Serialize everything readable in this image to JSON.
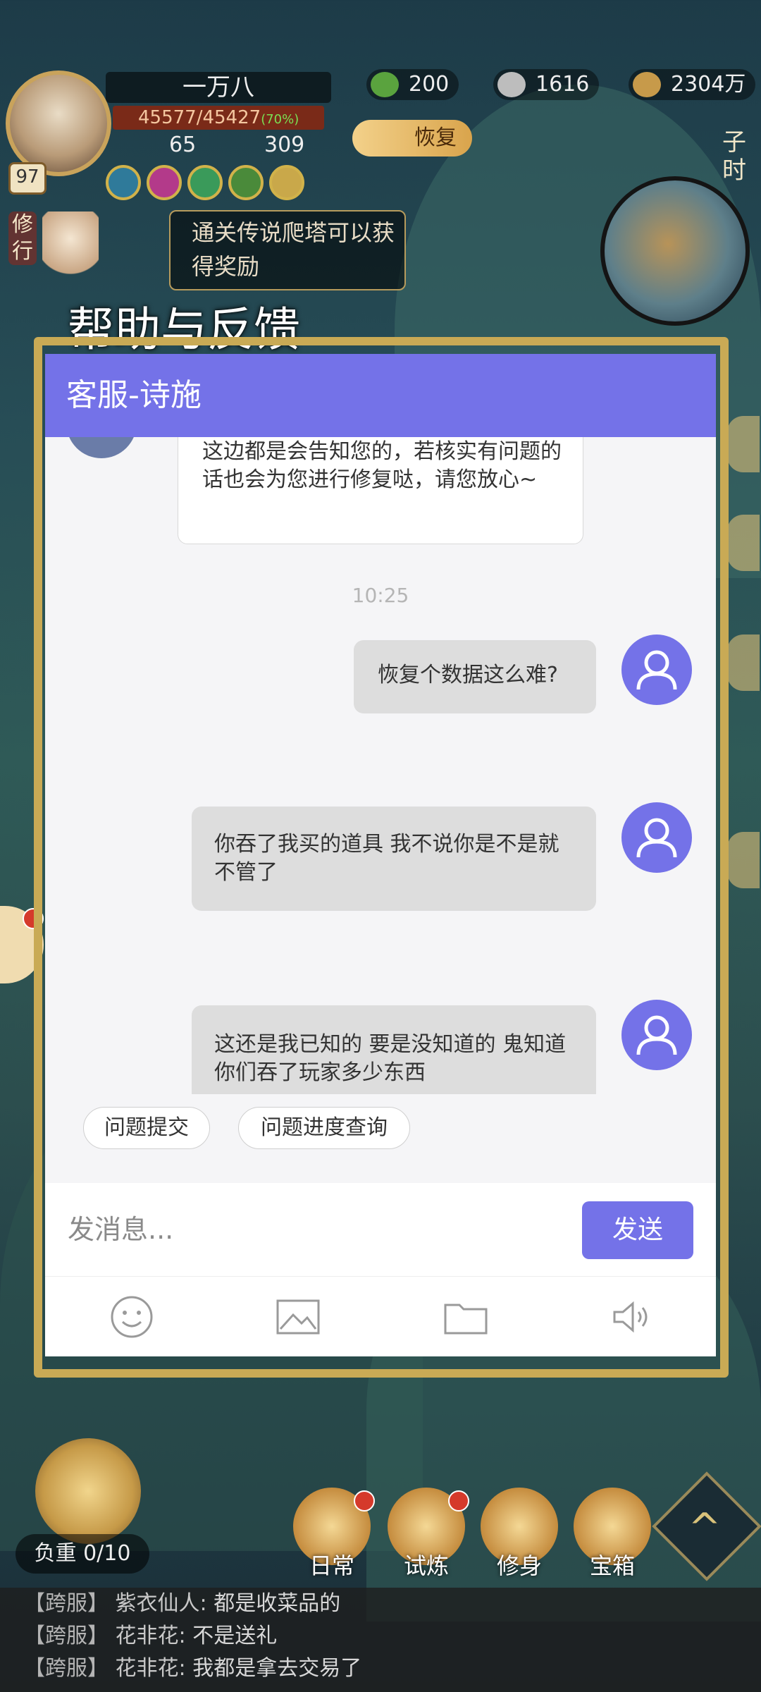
{
  "hud": {
    "player_name": "一万八",
    "level": "97",
    "hp_text": "45577/45427",
    "hp_percent_text": "(70%)",
    "stat_a": "65",
    "stat_b": "309",
    "currency_a": "200",
    "currency_b": "1616",
    "currency_c": "2304万",
    "restore_label": "恢复",
    "time_label": "子时",
    "xiuxing_label": "修行",
    "tip_text": "通关传说爬塔可以获得奖励"
  },
  "dialog": {
    "title": "帮助与反馈",
    "header": "客服-诗施",
    "agent_message": "这边都是会告知您的，若核实有问题的话也会为您进行修复哒，请您放心~",
    "timestamp": "10:25",
    "user_messages": [
      "恢复个数据这么难?",
      "你吞了我买的道具 我不说你是不是就不管了",
      "这还是我已知的 要是没知道的 鬼知道你们吞了玩家多少东西"
    ],
    "quick_buttons": [
      "问题提交",
      "问题进度查询"
    ],
    "input_placeholder": "发消息...",
    "send_label": "发送",
    "tools": [
      "emoji-icon",
      "image-icon",
      "folder-icon",
      "voice-icon"
    ],
    "accent_color": "#7472e8"
  },
  "bottom": {
    "carry_label": "负重 0/10",
    "buttons": [
      "日常",
      "试炼",
      "修身",
      "宝箱"
    ]
  },
  "world_chat": [
    {
      "tag": "【跨服】",
      "who": "紫衣仙人:",
      "text": "都是收菜品的"
    },
    {
      "tag": "【跨服】",
      "who": "花非花:",
      "text": "不是送礼"
    },
    {
      "tag": "【跨服】",
      "who": "花非花:",
      "text": "我都是拿去交易了"
    }
  ]
}
